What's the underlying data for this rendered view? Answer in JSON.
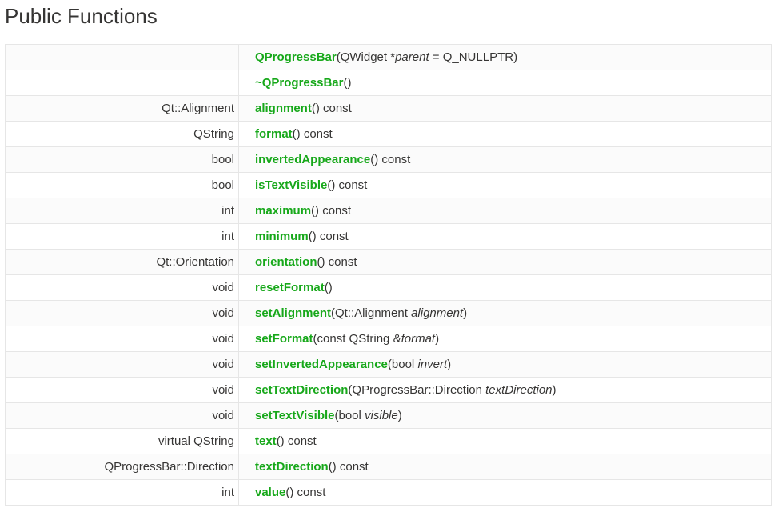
{
  "heading": "Public Functions",
  "rows": [
    {
      "ret": "",
      "name": "QProgressBar",
      "pre": "(QWidget *",
      "param": "parent",
      "post": " = Q_NULLPTR)"
    },
    {
      "ret": "",
      "name": "~QProgressBar",
      "pre": "()",
      "param": "",
      "post": ""
    },
    {
      "ret": "Qt::Alignment",
      "name": "alignment",
      "pre": "() const",
      "param": "",
      "post": ""
    },
    {
      "ret": "QString",
      "name": "format",
      "pre": "() const",
      "param": "",
      "post": ""
    },
    {
      "ret": "bool",
      "name": "invertedAppearance",
      "pre": "() const",
      "param": "",
      "post": ""
    },
    {
      "ret": "bool",
      "name": "isTextVisible",
      "pre": "() const",
      "param": "",
      "post": ""
    },
    {
      "ret": "int",
      "name": "maximum",
      "pre": "() const",
      "param": "",
      "post": ""
    },
    {
      "ret": "int",
      "name": "minimum",
      "pre": "() const",
      "param": "",
      "post": ""
    },
    {
      "ret": "Qt::Orientation",
      "name": "orientation",
      "pre": "() const",
      "param": "",
      "post": ""
    },
    {
      "ret": "void",
      "name": "resetFormat",
      "pre": "()",
      "param": "",
      "post": ""
    },
    {
      "ret": "void",
      "name": "setAlignment",
      "pre": "(Qt::Alignment ",
      "param": "alignment",
      "post": ")"
    },
    {
      "ret": "void",
      "name": "setFormat",
      "pre": "(const QString &",
      "param": "format",
      "post": ")"
    },
    {
      "ret": "void",
      "name": "setInvertedAppearance",
      "pre": "(bool ",
      "param": "invert",
      "post": ")"
    },
    {
      "ret": "void",
      "name": "setTextDirection",
      "pre": "(QProgressBar::Direction ",
      "param": "textDirection",
      "post": ")"
    },
    {
      "ret": "void",
      "name": "setTextVisible",
      "pre": "(bool ",
      "param": "visible",
      "post": ")"
    },
    {
      "ret": "virtual QString",
      "name": "text",
      "pre": "() const",
      "param": "",
      "post": ""
    },
    {
      "ret": "QProgressBar::Direction",
      "name": "textDirection",
      "pre": "() const",
      "param": "",
      "post": ""
    },
    {
      "ret": "int",
      "name": "value",
      "pre": "() const",
      "param": "",
      "post": ""
    }
  ]
}
